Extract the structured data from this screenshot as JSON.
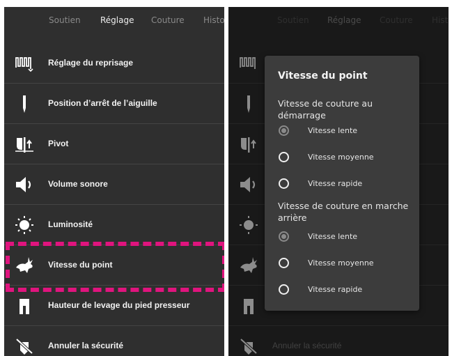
{
  "tabs": [
    "Soutien",
    "Réglage",
    "Couture",
    "Histo"
  ],
  "active_tab": "Réglage",
  "menu": [
    {
      "icon": "darning-icon",
      "label": "Réglage du reprisage"
    },
    {
      "icon": "needle-icon",
      "label": "Position d’arrêt de l’aiguille"
    },
    {
      "icon": "pivot-icon",
      "label": "Pivot"
    },
    {
      "icon": "speaker-icon",
      "label": "Volume sonore"
    },
    {
      "icon": "brightness-icon",
      "label": "Luminosité"
    },
    {
      "icon": "rabbit-icon",
      "label": "Vitesse du point"
    },
    {
      "icon": "presser-foot-icon",
      "label": "Hauteur de levage du pied presseur"
    },
    {
      "icon": "safety-off-icon",
      "label": "Annuler la sécurité"
    }
  ],
  "highlight_color": "#e0147e",
  "dialog": {
    "title": "Vitesse du point",
    "section1": {
      "label": "Vitesse de couture au démarrage",
      "options": [
        "Vitesse lente",
        "Vitesse moyenne",
        "Vitesse rapide"
      ],
      "selected": "Vitesse lente"
    },
    "section2": {
      "label": "Vitesse de couture en marche arrière",
      "options": [
        "Vitesse lente",
        "Vitesse moyenne",
        "Vitesse rapide"
      ],
      "selected": "Vitesse lente"
    }
  }
}
